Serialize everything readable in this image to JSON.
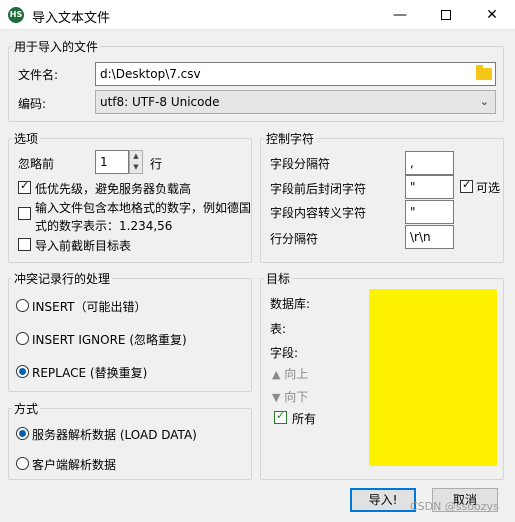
{
  "window": {
    "icon_text": "HS",
    "title": "导入文本文件",
    "minimize_glyph": "—",
    "close_glyph": "✕"
  },
  "import_file": {
    "legend": "用于导入的文件",
    "file_label": "文件名:",
    "file_value": "d:\\Desktop\\7.csv",
    "encoding_label": "编码:",
    "encoding_value": "utf8: UTF-8 Unicode"
  },
  "options": {
    "legend": "选项",
    "ignore_label": "忽略前",
    "ignore_value": "1",
    "ignore_unit": "行",
    "low_priority": {
      "label": "低优先级，避免服务器负载高",
      "checked": true
    },
    "local_number_line1": "输入文件包含本地格式的数字，例如德国",
    "local_number_line2": "式的数字表示：1.234,56",
    "local_number_checked": false,
    "truncate": {
      "label": "导入前截断目标表",
      "checked": false
    }
  },
  "control_chars": {
    "legend": "控制字符",
    "field_sep_label": "字段分隔符",
    "field_sep_value": ",",
    "enclose_label": "字段前后封闭字符",
    "enclose_value": "\"",
    "optional_label": "可选",
    "optional_checked": true,
    "escape_label": "字段内容转义字符",
    "escape_value": "\"",
    "line_sep_label": "行分隔符",
    "line_sep_value": "\\r\\n"
  },
  "conflict": {
    "legend": "冲突记录行的处理",
    "insert": "INSERT（可能出错）",
    "insert_ignore": "INSERT IGNORE (忽略重复)",
    "replace": "REPLACE (替换重复)",
    "selected": "replace"
  },
  "target": {
    "legend": "目标",
    "database_label": "数据库:",
    "table_label": "表:",
    "fields_label": "字段:",
    "up_label": "向上",
    "down_label": "向下",
    "all_label": "所有",
    "all_checked": true,
    "highlight_color": "#fff200"
  },
  "method": {
    "legend": "方式",
    "server": "服务器解析数据 (LOAD DATA)",
    "client": "客户端解析数据",
    "selected": "server"
  },
  "buttons": {
    "import": "导入!",
    "cancel": "取消"
  },
  "watermark": "CSDN @ssoozys"
}
